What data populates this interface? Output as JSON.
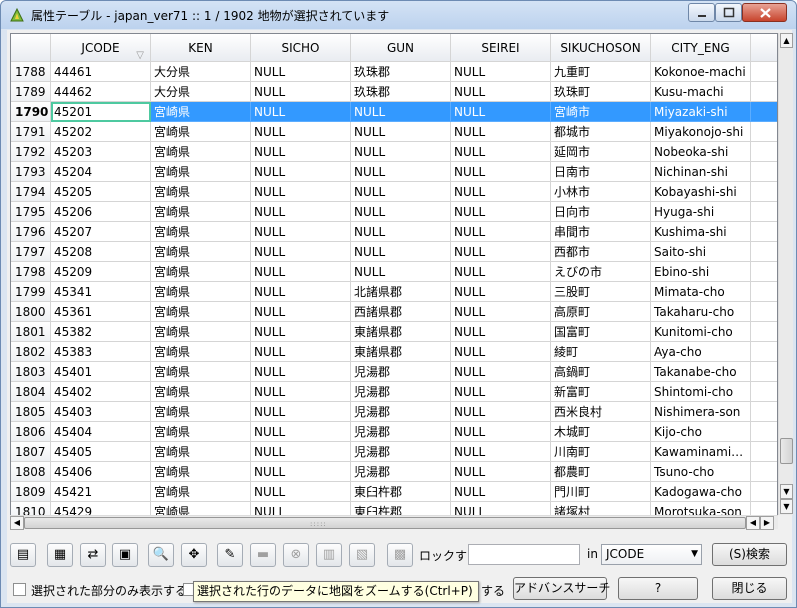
{
  "window": {
    "title": "属性テーブル - japan_ver71 :: 1 / 1902 地物が選択されています"
  },
  "table": {
    "columns": [
      "JCODE",
      "KEN",
      "SICHO",
      "GUN",
      "SEIREI",
      "SIKUCHOSON",
      "CITY_ENG"
    ],
    "selected_row_index": 2,
    "rows": [
      {
        "num": "1788",
        "cells": [
          "44461",
          "大分県",
          "NULL",
          "玖珠郡",
          "NULL",
          "九重町",
          "Kokonoe-machi"
        ]
      },
      {
        "num": "1789",
        "cells": [
          "44462",
          "大分県",
          "NULL",
          "玖珠郡",
          "NULL",
          "玖珠町",
          "Kusu-machi"
        ]
      },
      {
        "num": "1790",
        "cells": [
          "45201",
          "宮崎県",
          "NULL",
          "NULL",
          "NULL",
          "宮崎市",
          "Miyazaki-shi"
        ]
      },
      {
        "num": "1791",
        "cells": [
          "45202",
          "宮崎県",
          "NULL",
          "NULL",
          "NULL",
          "都城市",
          "Miyakonojo-shi"
        ]
      },
      {
        "num": "1792",
        "cells": [
          "45203",
          "宮崎県",
          "NULL",
          "NULL",
          "NULL",
          "延岡市",
          "Nobeoka-shi"
        ]
      },
      {
        "num": "1793",
        "cells": [
          "45204",
          "宮崎県",
          "NULL",
          "NULL",
          "NULL",
          "日南市",
          "Nichinan-shi"
        ]
      },
      {
        "num": "1794",
        "cells": [
          "45205",
          "宮崎県",
          "NULL",
          "NULL",
          "NULL",
          "小林市",
          "Kobayashi-shi"
        ]
      },
      {
        "num": "1795",
        "cells": [
          "45206",
          "宮崎県",
          "NULL",
          "NULL",
          "NULL",
          "日向市",
          "Hyuga-shi"
        ]
      },
      {
        "num": "1796",
        "cells": [
          "45207",
          "宮崎県",
          "NULL",
          "NULL",
          "NULL",
          "串間市",
          "Kushima-shi"
        ]
      },
      {
        "num": "1797",
        "cells": [
          "45208",
          "宮崎県",
          "NULL",
          "NULL",
          "NULL",
          "西都市",
          "Saito-shi"
        ]
      },
      {
        "num": "1798",
        "cells": [
          "45209",
          "宮崎県",
          "NULL",
          "NULL",
          "NULL",
          "えびの市",
          "Ebino-shi"
        ]
      },
      {
        "num": "1799",
        "cells": [
          "45341",
          "宮崎県",
          "NULL",
          "北諸県郡",
          "NULL",
          "三股町",
          "Mimata-cho"
        ]
      },
      {
        "num": "1800",
        "cells": [
          "45361",
          "宮崎県",
          "NULL",
          "西諸県郡",
          "NULL",
          "高原町",
          "Takaharu-cho"
        ]
      },
      {
        "num": "1801",
        "cells": [
          "45382",
          "宮崎県",
          "NULL",
          "東諸県郡",
          "NULL",
          "国富町",
          "Kunitomi-cho"
        ]
      },
      {
        "num": "1802",
        "cells": [
          "45383",
          "宮崎県",
          "NULL",
          "東諸県郡",
          "NULL",
          "綾町",
          "Aya-cho"
        ]
      },
      {
        "num": "1803",
        "cells": [
          "45401",
          "宮崎県",
          "NULL",
          "児湯郡",
          "NULL",
          "高鍋町",
          "Takanabe-cho"
        ]
      },
      {
        "num": "1804",
        "cells": [
          "45402",
          "宮崎県",
          "NULL",
          "児湯郡",
          "NULL",
          "新富町",
          "Shintomi-cho"
        ]
      },
      {
        "num": "1805",
        "cells": [
          "45403",
          "宮崎県",
          "NULL",
          "児湯郡",
          "NULL",
          "西米良村",
          "Nishimera-son"
        ]
      },
      {
        "num": "1806",
        "cells": [
          "45404",
          "宮崎県",
          "NULL",
          "児湯郡",
          "NULL",
          "木城町",
          "Kijo-cho"
        ]
      },
      {
        "num": "1807",
        "cells": [
          "45405",
          "宮崎県",
          "NULL",
          "児湯郡",
          "NULL",
          "川南町",
          "Kawaminami…"
        ]
      },
      {
        "num": "1808",
        "cells": [
          "45406",
          "宮崎県",
          "NULL",
          "児湯郡",
          "NULL",
          "都農町",
          "Tsuno-cho"
        ]
      },
      {
        "num": "1809",
        "cells": [
          "45421",
          "宮崎県",
          "NULL",
          "東臼杵郡",
          "NULL",
          "門川町",
          "Kadogawa-cho"
        ]
      },
      {
        "num": "1810",
        "cells": [
          "45429",
          "宮崎県",
          "NULL",
          "東臼杵郡",
          "NULL",
          "諸塚村",
          "Morotsuka-son"
        ]
      }
    ]
  },
  "toolbar": {
    "icons": [
      {
        "name": "table-icon",
        "glyph": "▤",
        "disabled": false
      },
      {
        "name": "select-all-icon",
        "glyph": "▦",
        "disabled": false
      },
      {
        "name": "invert-selection-icon",
        "glyph": "⇄",
        "disabled": false
      },
      {
        "name": "deselect-icon",
        "glyph": "▣",
        "disabled": false
      },
      {
        "name": "zoom-icon",
        "glyph": "🔍",
        "disabled": false
      },
      {
        "name": "pan-to-selection-icon",
        "glyph": "✥",
        "disabled": false
      },
      {
        "name": "edit-pencil-icon",
        "glyph": "✎",
        "disabled": false
      },
      {
        "name": "save-icon",
        "glyph": "▬",
        "disabled": true
      },
      {
        "name": "delete-icon",
        "glyph": "⊗",
        "disabled": true
      },
      {
        "name": "new-column-icon",
        "glyph": "▥",
        "disabled": true
      },
      {
        "name": "delete-column-icon",
        "glyph": "▧",
        "disabled": true
      },
      {
        "name": "field-calculator-icon",
        "glyph": "▩",
        "disabled": true
      }
    ],
    "lock_label": "ロックする",
    "search_value": "",
    "in_label": "in",
    "field_select": "JCODE",
    "search_button": "(S)検索"
  },
  "bottom": {
    "show_selected_only": "選択された部分のみ表示する",
    "second_checkbox_suffix": "する",
    "advanced_search": "アドバンスサーチ",
    "help": "?",
    "close": "閉じる"
  },
  "tooltip": "選択された行のデータに地図をズームする(Ctrl+P)"
}
